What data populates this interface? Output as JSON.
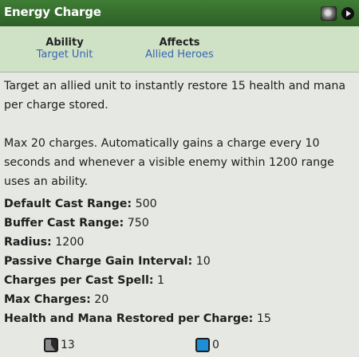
{
  "header": {
    "title": "Energy Charge"
  },
  "info": {
    "ability_label": "Ability",
    "ability_value": "Target Unit",
    "affects_label": "Affects",
    "affects_value": "Allied Heroes"
  },
  "description": {
    "paragraph1": "Target an allied unit to instantly restore 15 health and mana per charge stored.",
    "paragraph2": "Max 20 charges. Automatically gains a charge every 10 seconds and whenever a visible enemy within 1200 range uses an ability."
  },
  "stats": [
    {
      "label": "Default Cast Range:",
      "value": "500"
    },
    {
      "label": "Buffer Cast Range:",
      "value": "750"
    },
    {
      "label": "Radius:",
      "value": "1200"
    },
    {
      "label": "Passive Charge Gain Interval:",
      "value": "10"
    },
    {
      "label": "Charges per Cast Spell:",
      "value": "1"
    },
    {
      "label": "Max Charges:",
      "value": "20"
    },
    {
      "label": "Health and Mana Restored per Charge:",
      "value": "15"
    }
  ],
  "costs": {
    "cooldown": "13",
    "mana": "0"
  },
  "colors": {
    "header": "#2d5f26",
    "infobox": "#cfe2c6",
    "link": "#3a64b0",
    "mana": "#1e8fd6"
  },
  "icons": {
    "hero": "hero-portrait-icon",
    "play": "play-icon",
    "cooldown": "cooldown-icon",
    "mana": "mana-icon"
  }
}
